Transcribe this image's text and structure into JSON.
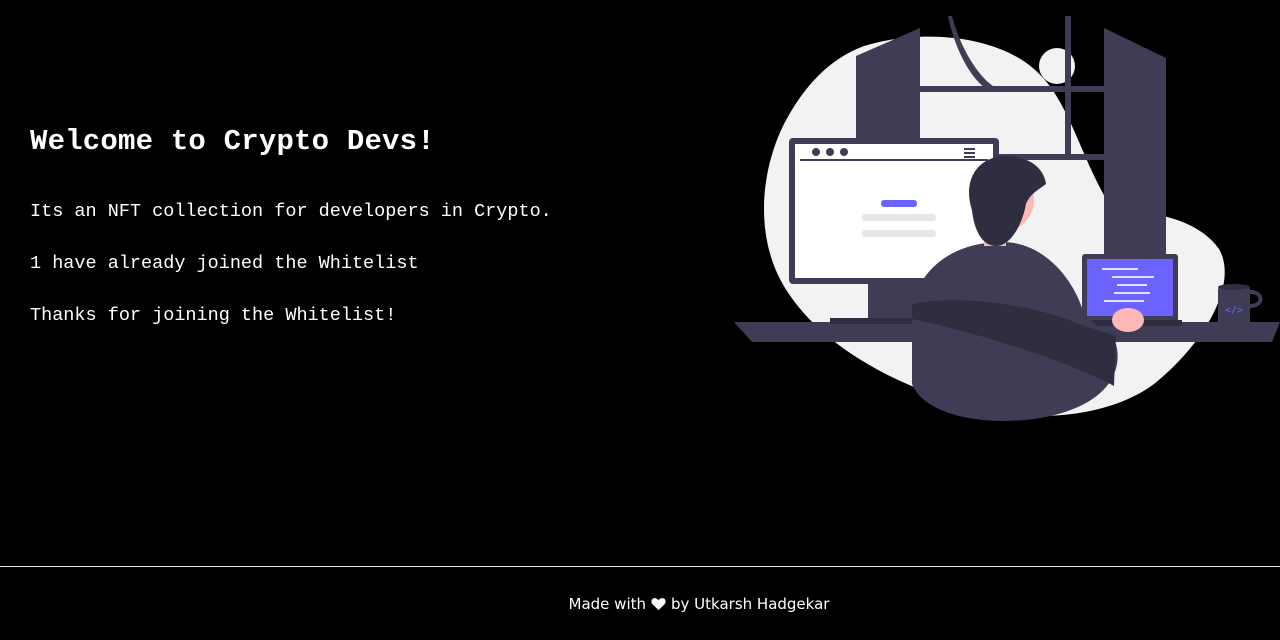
{
  "main": {
    "title": "Welcome to Crypto Devs!",
    "description": "Its an NFT collection for developers in Crypto.",
    "joined_text": "1 have already joined the Whitelist",
    "thanks_text": "Thanks for joining the Whitelist!",
    "illustration_icon": "developer-at-desk-illustration"
  },
  "footer": {
    "made_with": "Made with",
    "heart_icon": "heart-icon",
    "by_author": "by Utkarsh Hadgekar"
  },
  "colors": {
    "background": "#000000",
    "text": "#ffffff",
    "accent": "#6c63ff",
    "illustration_dark": "#3f3d56",
    "illustration_light": "#f2f2f2"
  }
}
